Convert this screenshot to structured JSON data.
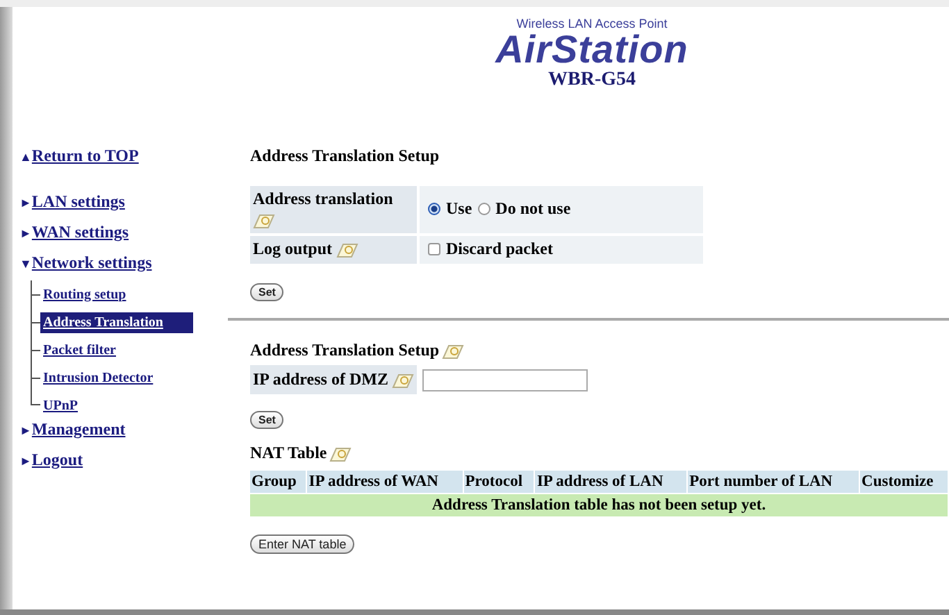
{
  "header": {
    "tagline": "Wireless LAN Access Point",
    "brand": "AirStation",
    "model": "WBR-G54"
  },
  "sidebar": {
    "items": [
      {
        "kind": "top",
        "icon": "▲",
        "label": "Return to TOP"
      },
      {
        "kind": "section",
        "icon": "►",
        "label": "LAN settings"
      },
      {
        "kind": "section",
        "icon": "►",
        "label": "WAN settings"
      },
      {
        "kind": "section",
        "icon": "▼",
        "label": "Network settings",
        "children": [
          {
            "label": "Routing setup",
            "selected": false
          },
          {
            "label": "Address Translation",
            "selected": true
          },
          {
            "label": "Packet filter",
            "selected": false
          },
          {
            "label": "Intrusion Detector",
            "selected": false
          },
          {
            "label": "UPnP",
            "selected": false
          }
        ]
      },
      {
        "kind": "section",
        "icon": "►",
        "label": "Management"
      },
      {
        "kind": "section",
        "icon": "►",
        "label": "Logout"
      }
    ]
  },
  "setup": {
    "title": "Address Translation Setup",
    "translation": {
      "label": "Address translation",
      "options": [
        {
          "label": "Use",
          "selected": true
        },
        {
          "label": "Do not use",
          "selected": false
        }
      ]
    },
    "log": {
      "label": "Log output",
      "option": {
        "label": "Discard packet",
        "checked": false
      }
    },
    "button": "Set"
  },
  "dmz": {
    "title": "Address Translation Setup",
    "label": "IP address of DMZ",
    "button": "Set"
  },
  "nat": {
    "title": "NAT Table",
    "columns": [
      "Group",
      "IP address of WAN",
      "Protocol",
      "IP address of LAN",
      "Port number of LAN",
      "Customize"
    ],
    "empty_message": "Address Translation table has not been setup yet.",
    "button": "Enter NAT table"
  }
}
